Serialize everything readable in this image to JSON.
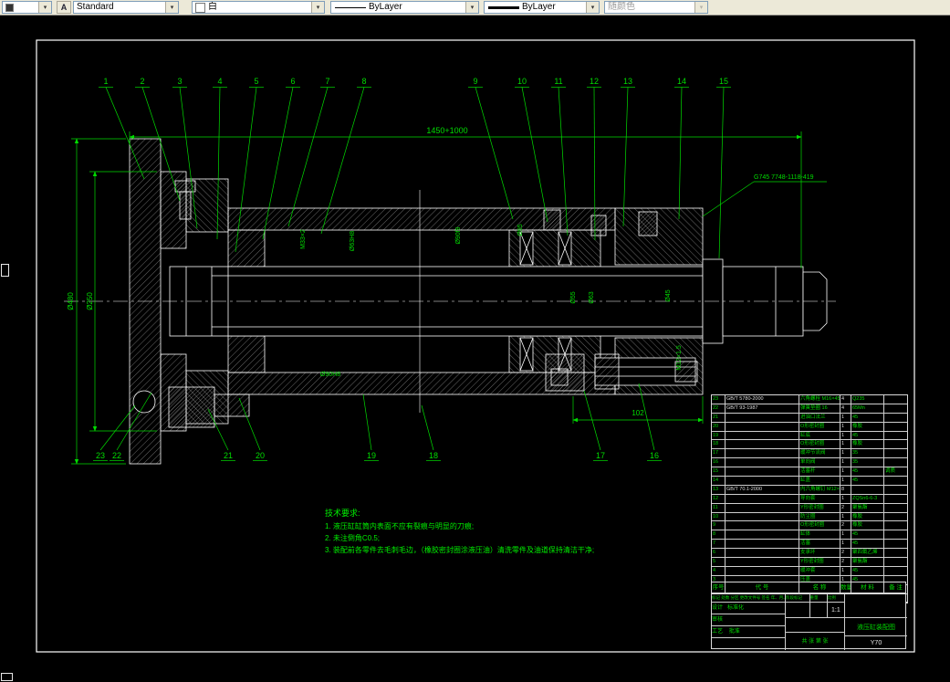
{
  "toolbar": {
    "dim_value": "",
    "text_style_value": "Standard",
    "text_style_icon_glyph": "A",
    "color_value": "白",
    "linetype_value": "ByLayer",
    "lineweight_value": "ByLayer",
    "plot_style_value": "随颜色",
    "arrow_glyph": "▼"
  },
  "drawing": {
    "dim_overall": "1450+1000",
    "dim_left_outer": "Ø480",
    "dim_left_inner": "Ø250",
    "dim_bottom": "102",
    "thread_note": "G745 7748-1118-419",
    "callouts_top": [
      "1",
      "2",
      "3",
      "4",
      "5",
      "6",
      "7",
      "8",
      "9",
      "10",
      "11",
      "12",
      "13",
      "14",
      "15"
    ],
    "callouts_bottom": [
      "23",
      "22",
      "21",
      "20",
      "19",
      "18",
      "17",
      "16"
    ],
    "inner_dims": [
      "M33×2",
      "Ø63H8",
      "Ø90f9",
      "Ø95",
      "Ø55",
      "Ø63",
      "Ø45",
      "M12×1.5",
      "Ø90H8"
    ],
    "tech_requirements": {
      "title": "技术要求:",
      "items": [
        "1. 液压缸缸筒内表面不应有裂痕与明显的刀痕;",
        "2. 未注倒角C0.5;",
        "3. 装配前各零件去毛刺毛边，（橡胶密封圈涂液压油）清洗零件及油道保持清洁干净;"
      ]
    }
  },
  "parts_list": {
    "headers": [
      "序号",
      "代  号",
      "名  称",
      "数量",
      "材 料",
      "备 注"
    ],
    "rows": [
      [
        "23",
        "GB/T 5780-2000",
        "六角螺栓 M16×45",
        "4",
        "Q235",
        ""
      ],
      [
        "22",
        "GB/T 93-1987",
        "弹簧垫圈 16",
        "4",
        "65Mn",
        ""
      ],
      [
        "21",
        "",
        "进油口法兰",
        "1",
        "45",
        ""
      ],
      [
        "20",
        "",
        "O形密封圈",
        "1",
        "橡胶",
        ""
      ],
      [
        "19",
        "",
        "缸底",
        "1",
        "45",
        ""
      ],
      [
        "18",
        "",
        "O形密封圈",
        "1",
        "橡胶",
        ""
      ],
      [
        "17",
        "",
        "缓冲节流阀",
        "1",
        "35",
        ""
      ],
      [
        "16",
        "",
        "单向阀",
        "1",
        "35",
        ""
      ],
      [
        "15",
        "",
        "活塞杆",
        "1",
        "45",
        "调质"
      ],
      [
        "14",
        "",
        "缸盖",
        "1",
        "45",
        ""
      ],
      [
        "13",
        "GB/T 70.1-2000",
        "内六角螺钉 M12×35",
        "8",
        "",
        ""
      ],
      [
        "12",
        "",
        "导向套",
        "1",
        "ZQSn6-6-3",
        ""
      ],
      [
        "11",
        "",
        "Y形密封圈",
        "2",
        "聚氨酯",
        ""
      ],
      [
        "10",
        "",
        "防尘圈",
        "1",
        "橡胶",
        ""
      ],
      [
        "9",
        "",
        "O形密封圈",
        "2",
        "橡胶",
        ""
      ],
      [
        "8",
        "",
        "缸体",
        "1",
        "45",
        ""
      ],
      [
        "7",
        "",
        "活塞",
        "1",
        "45",
        ""
      ],
      [
        "6",
        "",
        "支承环",
        "2",
        "聚四氟乙烯",
        ""
      ],
      [
        "5",
        "",
        "Y形密封圈",
        "2",
        "聚氨酯",
        ""
      ],
      [
        "4",
        "",
        "缓冲套",
        "1",
        "45",
        ""
      ],
      [
        "3",
        "",
        "压盖",
        "1",
        "45",
        ""
      ],
      [
        "2",
        "GB/T 5780-2000",
        "六角螺栓 M10×30",
        "6",
        "Q235",
        ""
      ],
      [
        "1",
        "",
        "法兰盘",
        "1",
        "45",
        ""
      ]
    ]
  },
  "title_block": {
    "revision_row": "标记 处数 分区 更改文件号 签名 年、月、日",
    "design_label": "设计",
    "standard_label": "标准化",
    "check_label": "审核",
    "process_label": "工艺",
    "approve_label": "批准",
    "stage_label": "阶段标记",
    "weight_label": "重量",
    "scale_label": "比例",
    "scale_value": "1:1",
    "sheet_info": "共 张 第 张",
    "title": "液压缸装配图",
    "code": "Y70"
  },
  "colors": {
    "cad_green": "#00dc00",
    "cad_white": "#ffffff",
    "toolbar_bg": "#ece9d8"
  }
}
